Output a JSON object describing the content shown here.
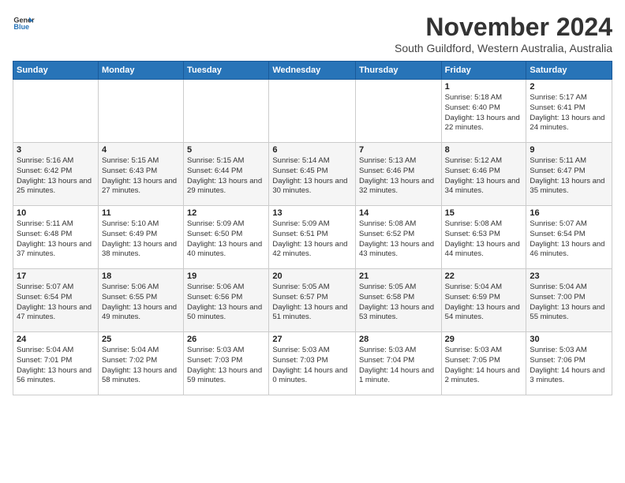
{
  "logo": {
    "line1": "General",
    "line2": "Blue"
  },
  "title": "November 2024",
  "subtitle": "South Guildford, Western Australia, Australia",
  "days_of_week": [
    "Sunday",
    "Monday",
    "Tuesday",
    "Wednesday",
    "Thursday",
    "Friday",
    "Saturday"
  ],
  "weeks": [
    [
      {
        "day": "",
        "info": ""
      },
      {
        "day": "",
        "info": ""
      },
      {
        "day": "",
        "info": ""
      },
      {
        "day": "",
        "info": ""
      },
      {
        "day": "",
        "info": ""
      },
      {
        "day": "1",
        "info": "Sunrise: 5:18 AM\nSunset: 6:40 PM\nDaylight: 13 hours and 22 minutes."
      },
      {
        "day": "2",
        "info": "Sunrise: 5:17 AM\nSunset: 6:41 PM\nDaylight: 13 hours and 24 minutes."
      }
    ],
    [
      {
        "day": "3",
        "info": "Sunrise: 5:16 AM\nSunset: 6:42 PM\nDaylight: 13 hours and 25 minutes."
      },
      {
        "day": "4",
        "info": "Sunrise: 5:15 AM\nSunset: 6:43 PM\nDaylight: 13 hours and 27 minutes."
      },
      {
        "day": "5",
        "info": "Sunrise: 5:15 AM\nSunset: 6:44 PM\nDaylight: 13 hours and 29 minutes."
      },
      {
        "day": "6",
        "info": "Sunrise: 5:14 AM\nSunset: 6:45 PM\nDaylight: 13 hours and 30 minutes."
      },
      {
        "day": "7",
        "info": "Sunrise: 5:13 AM\nSunset: 6:46 PM\nDaylight: 13 hours and 32 minutes."
      },
      {
        "day": "8",
        "info": "Sunrise: 5:12 AM\nSunset: 6:46 PM\nDaylight: 13 hours and 34 minutes."
      },
      {
        "day": "9",
        "info": "Sunrise: 5:11 AM\nSunset: 6:47 PM\nDaylight: 13 hours and 35 minutes."
      }
    ],
    [
      {
        "day": "10",
        "info": "Sunrise: 5:11 AM\nSunset: 6:48 PM\nDaylight: 13 hours and 37 minutes."
      },
      {
        "day": "11",
        "info": "Sunrise: 5:10 AM\nSunset: 6:49 PM\nDaylight: 13 hours and 38 minutes."
      },
      {
        "day": "12",
        "info": "Sunrise: 5:09 AM\nSunset: 6:50 PM\nDaylight: 13 hours and 40 minutes."
      },
      {
        "day": "13",
        "info": "Sunrise: 5:09 AM\nSunset: 6:51 PM\nDaylight: 13 hours and 42 minutes."
      },
      {
        "day": "14",
        "info": "Sunrise: 5:08 AM\nSunset: 6:52 PM\nDaylight: 13 hours and 43 minutes."
      },
      {
        "day": "15",
        "info": "Sunrise: 5:08 AM\nSunset: 6:53 PM\nDaylight: 13 hours and 44 minutes."
      },
      {
        "day": "16",
        "info": "Sunrise: 5:07 AM\nSunset: 6:54 PM\nDaylight: 13 hours and 46 minutes."
      }
    ],
    [
      {
        "day": "17",
        "info": "Sunrise: 5:07 AM\nSunset: 6:54 PM\nDaylight: 13 hours and 47 minutes."
      },
      {
        "day": "18",
        "info": "Sunrise: 5:06 AM\nSunset: 6:55 PM\nDaylight: 13 hours and 49 minutes."
      },
      {
        "day": "19",
        "info": "Sunrise: 5:06 AM\nSunset: 6:56 PM\nDaylight: 13 hours and 50 minutes."
      },
      {
        "day": "20",
        "info": "Sunrise: 5:05 AM\nSunset: 6:57 PM\nDaylight: 13 hours and 51 minutes."
      },
      {
        "day": "21",
        "info": "Sunrise: 5:05 AM\nSunset: 6:58 PM\nDaylight: 13 hours and 53 minutes."
      },
      {
        "day": "22",
        "info": "Sunrise: 5:04 AM\nSunset: 6:59 PM\nDaylight: 13 hours and 54 minutes."
      },
      {
        "day": "23",
        "info": "Sunrise: 5:04 AM\nSunset: 7:00 PM\nDaylight: 13 hours and 55 minutes."
      }
    ],
    [
      {
        "day": "24",
        "info": "Sunrise: 5:04 AM\nSunset: 7:01 PM\nDaylight: 13 hours and 56 minutes."
      },
      {
        "day": "25",
        "info": "Sunrise: 5:04 AM\nSunset: 7:02 PM\nDaylight: 13 hours and 58 minutes."
      },
      {
        "day": "26",
        "info": "Sunrise: 5:03 AM\nSunset: 7:03 PM\nDaylight: 13 hours and 59 minutes."
      },
      {
        "day": "27",
        "info": "Sunrise: 5:03 AM\nSunset: 7:03 PM\nDaylight: 14 hours and 0 minutes."
      },
      {
        "day": "28",
        "info": "Sunrise: 5:03 AM\nSunset: 7:04 PM\nDaylight: 14 hours and 1 minute."
      },
      {
        "day": "29",
        "info": "Sunrise: 5:03 AM\nSunset: 7:05 PM\nDaylight: 14 hours and 2 minutes."
      },
      {
        "day": "30",
        "info": "Sunrise: 5:03 AM\nSunset: 7:06 PM\nDaylight: 14 hours and 3 minutes."
      }
    ]
  ]
}
